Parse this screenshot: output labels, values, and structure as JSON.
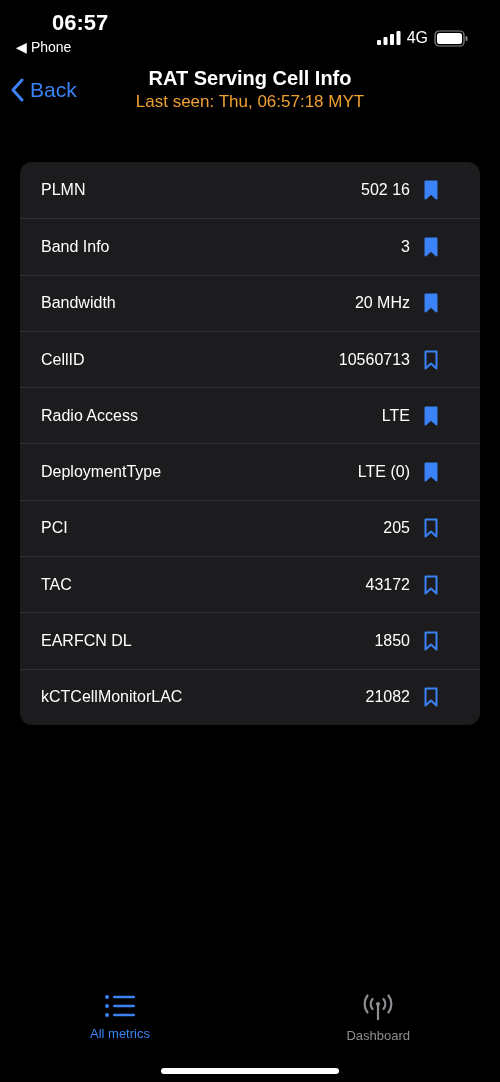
{
  "status_bar": {
    "time": "06:57",
    "back_app": "◀ Phone",
    "network": "4G"
  },
  "nav": {
    "back": "Back",
    "title": "RAT Serving Cell Info",
    "subtitle": "Last seen: Thu, 06:57:18 MYT"
  },
  "rows": [
    {
      "label": "PLMN",
      "value": "502 16",
      "bookmarked": true
    },
    {
      "label": "Band Info",
      "value": "3",
      "bookmarked": true
    },
    {
      "label": "Bandwidth",
      "value": "20 MHz",
      "bookmarked": true
    },
    {
      "label": "CellID",
      "value": "10560713",
      "bookmarked": false
    },
    {
      "label": "Radio Access",
      "value": "LTE",
      "bookmarked": true
    },
    {
      "label": "DeploymentType",
      "value": "LTE (0)",
      "bookmarked": true
    },
    {
      "label": "PCI",
      "value": "205",
      "bookmarked": false
    },
    {
      "label": "TAC",
      "value": "43172",
      "bookmarked": false
    },
    {
      "label": "EARFCN DL",
      "value": "1850",
      "bookmarked": false
    },
    {
      "label": "kCTCellMonitorLAC",
      "value": "21082",
      "bookmarked": false
    }
  ],
  "tabs": [
    {
      "kind": "list",
      "label": "All metrics",
      "selected": true
    },
    {
      "kind": "antenna",
      "label": "Dashboard",
      "selected": false
    }
  ]
}
